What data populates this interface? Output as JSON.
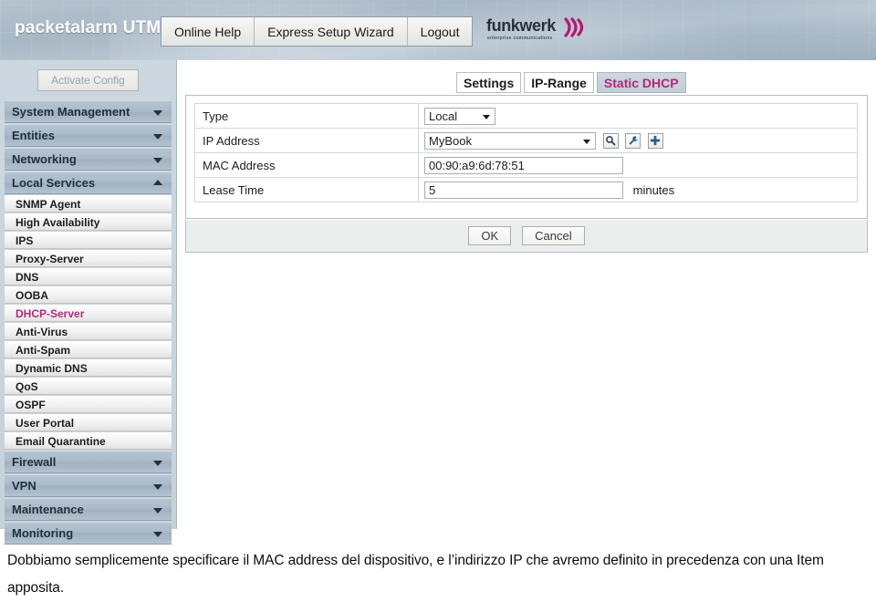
{
  "header": {
    "brand": "packetalarm UTM",
    "nav": [
      {
        "label": "Online Help"
      },
      {
        "label": "Express Setup Wizard"
      },
      {
        "label": "Logout"
      }
    ],
    "logo": {
      "word": "funkwerk",
      "tagline": "enterprise communications",
      "accent_color": "#b5186f"
    }
  },
  "sidebar": {
    "activate_button": "Activate Config",
    "groups": [
      {
        "label": "System Management",
        "expanded": false,
        "items": []
      },
      {
        "label": "Entities",
        "expanded": false,
        "items": []
      },
      {
        "label": "Networking",
        "expanded": false,
        "items": []
      },
      {
        "label": "Local Services",
        "expanded": true,
        "items": [
          {
            "label": "SNMP Agent",
            "active": false
          },
          {
            "label": "High Availability",
            "active": false
          },
          {
            "label": "IPS",
            "active": false
          },
          {
            "label": "Proxy-Server",
            "active": false
          },
          {
            "label": "DNS",
            "active": false
          },
          {
            "label": "OOBA",
            "active": false
          },
          {
            "label": "DHCP-Server",
            "active": true
          },
          {
            "label": "Anti-Virus",
            "active": false
          },
          {
            "label": "Anti-Spam",
            "active": false
          },
          {
            "label": "Dynamic DNS",
            "active": false
          },
          {
            "label": "QoS",
            "active": false
          },
          {
            "label": "OSPF",
            "active": false
          },
          {
            "label": "User Portal",
            "active": false
          },
          {
            "label": "Email Quarantine",
            "active": false
          }
        ]
      },
      {
        "label": "Firewall",
        "expanded": false,
        "items": []
      },
      {
        "label": "VPN",
        "expanded": false,
        "items": []
      },
      {
        "label": "Maintenance",
        "expanded": false,
        "items": []
      },
      {
        "label": "Monitoring",
        "expanded": false,
        "items": []
      }
    ],
    "active_item_color": "#b02a7a"
  },
  "main": {
    "tabs": [
      {
        "label": "Settings",
        "active": false
      },
      {
        "label": "IP-Range",
        "active": false
      },
      {
        "label": "Static DHCP",
        "active": true
      }
    ],
    "form": {
      "rows": [
        {
          "label": "Type",
          "value": "Local"
        },
        {
          "label": "IP Address",
          "value": "MyBook"
        },
        {
          "label": "MAC Address",
          "value": "00:90:a9:6d:78:51"
        },
        {
          "label": "Lease Time",
          "value": "5",
          "unit": "minutes"
        }
      ],
      "icons": [
        {
          "name": "magnifier-icon"
        },
        {
          "name": "wrench-icon"
        },
        {
          "name": "plus-icon"
        }
      ]
    },
    "buttons": {
      "ok": "OK",
      "cancel": "Cancel"
    }
  },
  "caption": {
    "text": "Dobbiamo semplicemente specificare il MAC address del dispositivo, e l’indirizzo IP che avremo definito in precedenza con una Item apposita."
  }
}
